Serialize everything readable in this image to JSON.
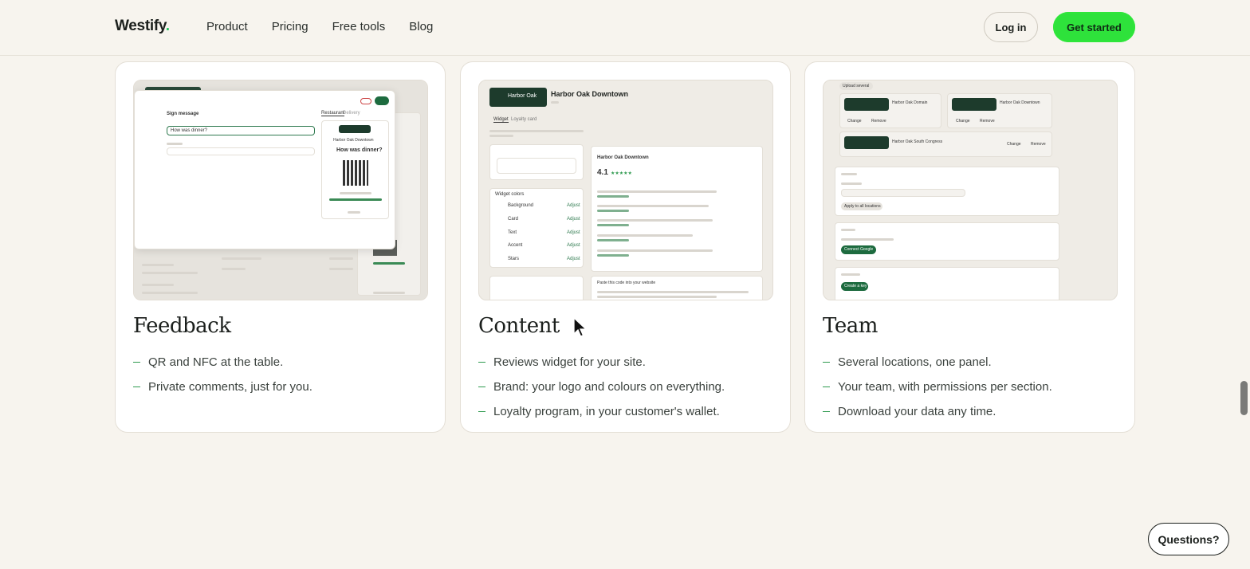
{
  "header": {
    "logo": "Westify",
    "logo_dot": ".",
    "nav": [
      "Product",
      "Pricing",
      "Free tools",
      "Blog"
    ],
    "login_label": "Log in",
    "cta_label": "Get started"
  },
  "cards": [
    {
      "title": "Feedback",
      "features": [
        "QR and NFC at the table.",
        "Private comments, just for you."
      ],
      "preview": {
        "sign_message": "Sign message",
        "question": "How was dinner?",
        "brand": "Harbor Oak Downtown",
        "tab_a": "Restaurant",
        "tab_b": "Delivery"
      }
    },
    {
      "title": "Content",
      "features": [
        "Reviews widget for your site.",
        "Brand: your logo and colours on everything.",
        "Loyalty program, in your customer's wallet."
      ],
      "preview": {
        "brand": "Harbor Oak Downtown",
        "logo_text": "Harbor Oak",
        "tab_a": "Widget",
        "tab_b": "Loyalty card",
        "rating": "4.1",
        "widget_colors": "Widget colors",
        "color_rows": [
          "Background",
          "Card",
          "Text",
          "Accent",
          "Stars"
        ],
        "adjust": "Adjust",
        "embed": "Paste this code into your website"
      }
    },
    {
      "title": "Team",
      "features": [
        "Several locations, one panel.",
        "Your team, with permissions per section.",
        "Download your data any time."
      ],
      "preview": {
        "upload": "Upload several",
        "loc_a": "Harbor Oak Domain",
        "loc_b": "Harbor Oak Downtown",
        "loc_c": "Harbor Oak South Congress",
        "change": "Change",
        "remove": "Remove",
        "apply_btn": "Apply to all locations",
        "connect_btn": "Connect Google",
        "create_btn": "Create a key"
      }
    }
  ],
  "questions_label": "Questions?",
  "colors": {
    "accent": "#2ee23b",
    "brand_dark": "#1d3b2c",
    "background": "#f7f4ee"
  }
}
